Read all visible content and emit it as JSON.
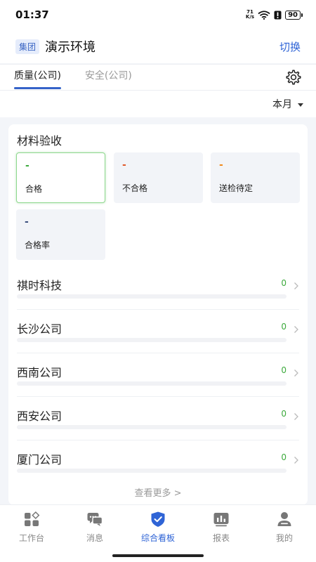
{
  "status_bar": {
    "time": "01:37",
    "net_speed_top": "71",
    "net_speed_bottom": "K/s",
    "battery": "90"
  },
  "header": {
    "org_badge": "集团",
    "org_name": "演示环境",
    "switch_label": "切换"
  },
  "tabs": [
    {
      "label": "质量(公司)",
      "active": true
    },
    {
      "label": "安全(公司)",
      "active": false
    }
  ],
  "period": {
    "selected": "本月"
  },
  "material_card": {
    "title": "材料验收",
    "stats": [
      {
        "value": "-",
        "label": "合格"
      },
      {
        "value": "-",
        "label": "不合格"
      },
      {
        "value": "-",
        "label": "送检待定"
      },
      {
        "value": "-",
        "label": "合格率"
      }
    ],
    "companies": [
      {
        "name": "祺时科技",
        "count": "0",
        "progress": 0
      },
      {
        "name": "长沙公司",
        "count": "0",
        "progress": 0
      },
      {
        "name": "西南公司",
        "count": "0",
        "progress": 0
      },
      {
        "name": "西安公司",
        "count": "0",
        "progress": 0
      },
      {
        "name": "厦门公司",
        "count": "0",
        "progress": 0
      }
    ],
    "more_label": "查看更多 >"
  },
  "bottom_nav": [
    {
      "label": "工作台",
      "icon": "workbench-icon",
      "active": false
    },
    {
      "label": "消息",
      "icon": "message-icon",
      "active": false
    },
    {
      "label": "综合看板",
      "icon": "dashboard-shield-icon",
      "active": true
    },
    {
      "label": "报表",
      "icon": "report-icon",
      "active": false
    },
    {
      "label": "我的",
      "icon": "profile-icon",
      "active": false
    }
  ],
  "colors": {
    "accent": "#2f64d6",
    "pass_green": "#3daa3d",
    "fail_red": "#e05a2a",
    "pending_orange": "#f08a1c"
  }
}
